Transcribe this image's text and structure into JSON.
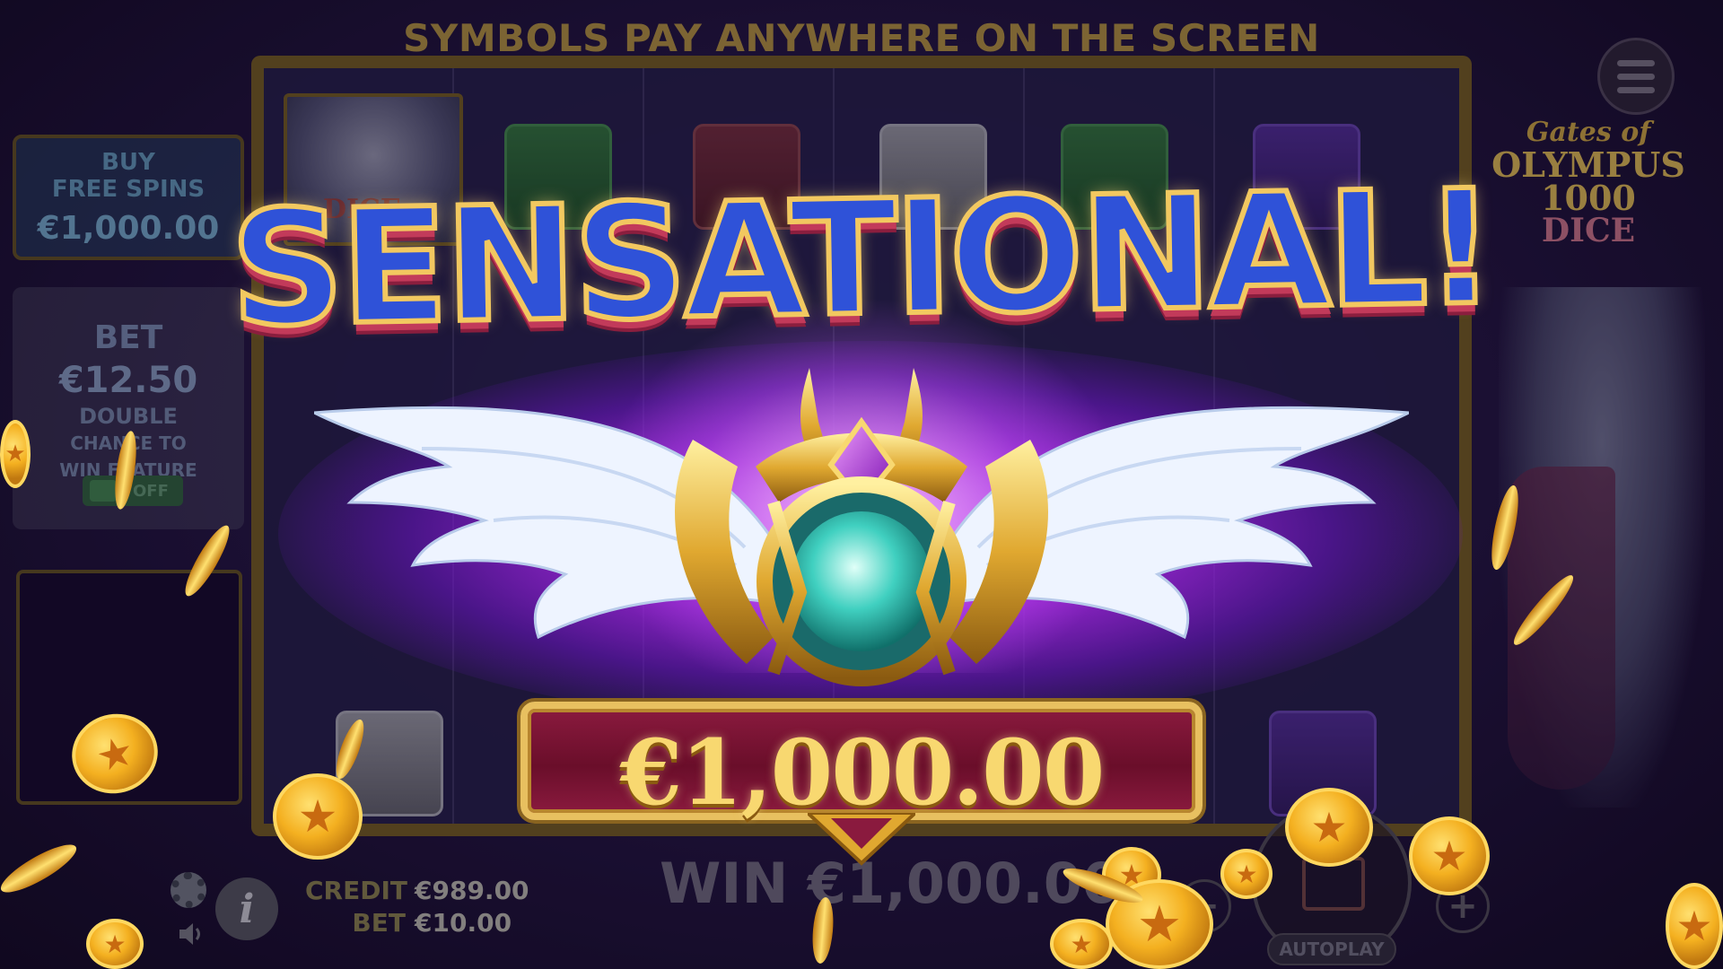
{
  "header": {
    "banner_text": "SYMBOLS PAY ANYWHERE ON THE SCREEN"
  },
  "buy_feature": {
    "line1": "BUY",
    "line2": "FREE SPINS",
    "price": "€1,000.00"
  },
  "bet_panel": {
    "label": "BET",
    "amount": "€12.50",
    "feature_line1": "DOUBLE",
    "feature_line2": "CHANCE TO",
    "feature_line3": "WIN FEATURE",
    "toggle_label": "OFF"
  },
  "logo": {
    "line1": "Gates of",
    "line2": "OLYMPUS",
    "line3": "1000",
    "line4": "DICE"
  },
  "reel_symbol_label": "DICE",
  "win_celebration": {
    "title": "SENSATIONAL!",
    "amount": "€1,000.00"
  },
  "bottom_bar": {
    "credit_label": "CREDIT",
    "credit_value": "€989.00",
    "bet_label": "BET",
    "bet_value": "€10.00",
    "win_text": "WIN €1,000.00",
    "autoplay_label": "AUTOPLAY",
    "minus_label": "−",
    "plus_label": "+"
  },
  "icons": [
    "menu-icon",
    "gear-icon",
    "info-icon",
    "speaker-icon",
    "spin-icon",
    "star-coin-icon"
  ],
  "colors": {
    "title_fill": "#2f52d8",
    "title_outline": "#f2c860",
    "plate_red": "#8a1a3e",
    "gold": "#f8d870",
    "purple_glow": "#aa28e6"
  }
}
